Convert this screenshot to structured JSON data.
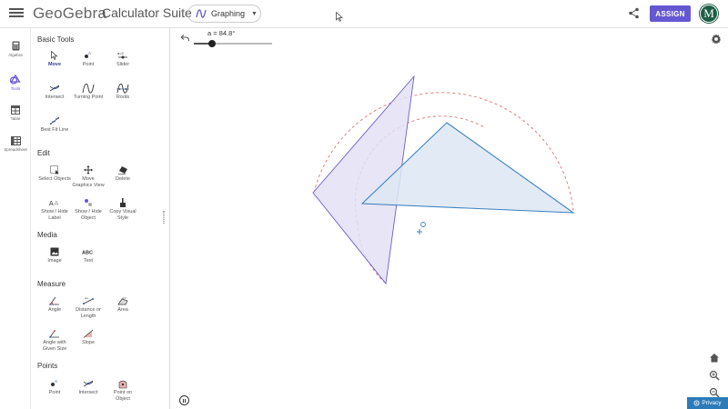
{
  "header": {
    "logo_text": "GeoGebra",
    "suite_title": "Calculator Suite",
    "app_switch_label": "Graphing",
    "assign_label": "ASSIGN",
    "avatar_initial": "M"
  },
  "rail": [
    {
      "label": "Algebra",
      "icon": "calculator-icon"
    },
    {
      "label": "Tools",
      "icon": "shapes-icon"
    },
    {
      "label": "Table",
      "icon": "table-icon"
    },
    {
      "label": "Spreadsheet",
      "icon": "spreadsheet-icon"
    }
  ],
  "sections": {
    "basic": "Basic Tools",
    "edit": "Edit",
    "media": "Media",
    "measure": "Measure",
    "points": "Points"
  },
  "tools": {
    "move": "Move",
    "point": "Point",
    "slider": "Slider",
    "intersect": "Intersect",
    "turning_point": "Turning Point",
    "roots": "Roots",
    "best_fit_line": "Best Fit Line",
    "select_objects": "Select Objects",
    "move_graphics_view_1": "Move",
    "move_graphics_view_2": "Graphics View",
    "delete": "Delete",
    "show_hide_label_1": "Show / Hide",
    "show_hide_label_2": "Label",
    "show_hide_object_1": "Show / Hide",
    "show_hide_object_2": "Object",
    "copy_visual_style_1": "Copy Visual",
    "copy_visual_style_2": "Style",
    "image": "Image",
    "text": "Text",
    "angle": "Angle",
    "distance_1": "Distance or",
    "distance_2": "Length",
    "area": "Area",
    "angle_given_size_1": "Angle with",
    "angle_given_size_2": "Given Size",
    "slope": "Slope",
    "point2": "Point",
    "intersect2": "Intersect",
    "point_on_object_1": "Point on",
    "point_on_object_2": "Object"
  },
  "slider": {
    "label": "a = 84.8°",
    "value_deg": 84.8,
    "min_deg": 0,
    "max_deg": 360
  },
  "privacy_label": "Privacy",
  "colors": {
    "accent": "#6557d2",
    "avatar": "#1f5e46",
    "privacy": "#2b7bb9",
    "triangle_fill": "#dde8f3",
    "triangle_stroke": "#3f82c2",
    "rotated_fill": "#e3e0f5",
    "rotated_stroke": "#6b5fd0",
    "arc_color": "#e07070"
  }
}
